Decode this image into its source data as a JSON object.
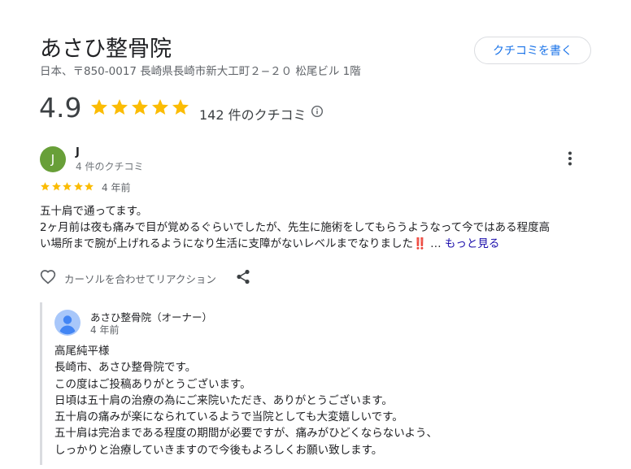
{
  "business": {
    "name": "あさひ整骨院",
    "address": "日本、〒850-0017 長崎県長崎市新大工町２−２０ 松尾ビル 1階",
    "write_review_label": "クチコミを書く",
    "rating": "4.9",
    "rating_stars": 5,
    "review_count_label": "142 件のクチコミ"
  },
  "review": {
    "avatar_letter": "J",
    "avatar_color": "#689f38",
    "reviewer_name": "J",
    "reviewer_review_count": "4 件のクチコミ",
    "stars": 5,
    "date": "4 年前",
    "text_lines": [
      "五十肩で通ってます。",
      "2ヶ月前は夜も痛みで目が覚めるぐらいでしたが、先生に施術をしてもらうようなって今ではある程度高",
      "い場所まで腕が上げれるようになり生活に支障がないレベルまでなりました"
    ],
    "emoji": "‼️",
    "ellipsis": " … ",
    "more_label": "もっと見る",
    "reaction_label": "カーソルを合わせてリアクション"
  },
  "owner_reply": {
    "name": "あさひ整骨院（オーナー）",
    "date": "4 年前",
    "lines": [
      "高尾純平様",
      "長崎市、あさひ整骨院です。",
      "この度はご投稿ありがとうございます。",
      "日頃は五十肩の治療の為にご来院いただき、ありがとうございます。",
      "五十肩の痛みが楽になられているようで当院としても大変嬉しいです。",
      "五十肩は完治まである程度の期間が必要ですが、痛みがひどくならないよう、",
      "しっかりと治療していきますので今後もよろしくお願い致します。"
    ]
  },
  "colors": {
    "star": "#fbbc04",
    "link": "#1a0dab",
    "button_text": "#1a73e8",
    "owner_avatar": "#4285f4"
  },
  "icons": [
    "star-icon",
    "info-icon",
    "more-vert-icon",
    "heart-icon",
    "share-icon",
    "person-icon"
  ]
}
